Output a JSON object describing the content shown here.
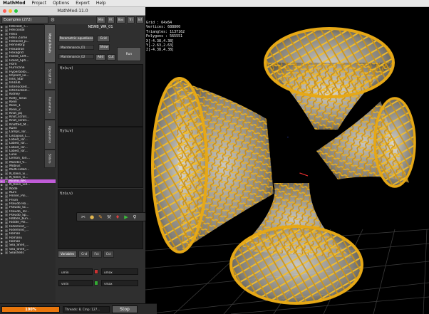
{
  "menu": {
    "app": "MathMod",
    "items": [
      "Project",
      "Options",
      "Export",
      "Help"
    ]
  },
  "window": {
    "title": "MathMod-11.0"
  },
  "sidebar": {
    "combo": "Examples (272)",
    "items": [
      "Helicoid_T...",
      "Helicoidal",
      "Helix",
      "Helix Zome",
      "Helloclid_p...",
      "Hennebrg",
      "Hexadron",
      "Hexagrid",
      "Holed_Cliff...",
      "Holed_Sph...",
      "Horn",
      "Hurricane",
      "Hyperboloi...",
      "Implicit_Le...",
      "Inks_Star",
      "InkDub",
      "Interlocked...",
      "Interlocked...",
      "Kidney",
      "Kidly_Torus",
      "Klein",
      "Klein_1",
      "Klein_2",
      "Knot_pq",
      "Knot_scroll...",
      "Knot_scroll...",
      "Knotted_M...",
      "Kuen",
      "Lamps_Tor...",
      "Lissajous_L...",
      "Lobed_Tor...",
      "Lobed_Tor...",
      "Lobed_Tor...",
      "Lobed_Tor...",
      "Lune",
      "Lemon_Tori...",
      "Mandel_V...",
      "Mobius",
      "Multi-sided...",
      "N_Klein_vi...",
      "N_Klein_vi...",
      "NEWB_WR...",
      "N_Klein_vid...",
      "Node",
      "Nurs",
      "Pinner_Pin...",
      "Prism",
      "Pseudo Ho...",
      "Pseudo_Sc...",
      "Pseudo_Tor...",
      "Pseudo_Sp...",
      "Ribbon_bun...",
      "Riddle_Pie...",
      "Ridemind_...",
      "Ridemind_...",
      "Roman",
      "Romanu",
      "Roman",
      "Sea_Shell_...",
      "Sea_Shell_...",
      "Seashells"
    ],
    "selected_index": 41
  },
  "vtabs": [
    "Model Details",
    "Script Edit",
    "Parameters",
    "Appearance",
    "Sliders"
  ],
  "panel": {
    "toolbar": [
      "Min",
      "Fit",
      "Box",
      "Tri",
      "Inf"
    ],
    "surface_name": "NEWB_WR_01",
    "param_btn": "Parametric equations",
    "grid_btn": "Grid",
    "slider1": "Maintenance_01",
    "slider2": "Maintenance_02",
    "show_btn": "Show",
    "run_btn": "Run",
    "add_btn": "Add",
    "cut_btn": "Cut",
    "fx_label": "f(x(u,v)",
    "fy_label": "f(y(u,v)",
    "fz_label": "f(z(u,v)",
    "tabs": [
      "Variables",
      "Cnd",
      "Fct",
      "Cst"
    ],
    "umin": "umin",
    "umax": "umax",
    "vmin": "vmin",
    "vmax": "vmax"
  },
  "status": {
    "progress": "100%",
    "progress_value": 1.0,
    "text": "Threads: 8, Cmp: 127...",
    "stop": "Stop"
  },
  "stats": {
    "grid": "Grid    : 64x64",
    "vertices": "Vertices: 688800",
    "triangles": "Triangles: 1137162",
    "polygons": "Polygons : 565551",
    "x": "X[-4.38,4.38]",
    "y": "Y[-2.63,2.63]",
    "z": "Z[-4.38,4.38]"
  },
  "colors": {
    "mesh_gold": "#f0b41e",
    "mesh_dark": "#9b6a00",
    "surface_glass": "#c9c4b8",
    "highlight": "#c05cd8",
    "progress_orange": "#e8760c"
  }
}
